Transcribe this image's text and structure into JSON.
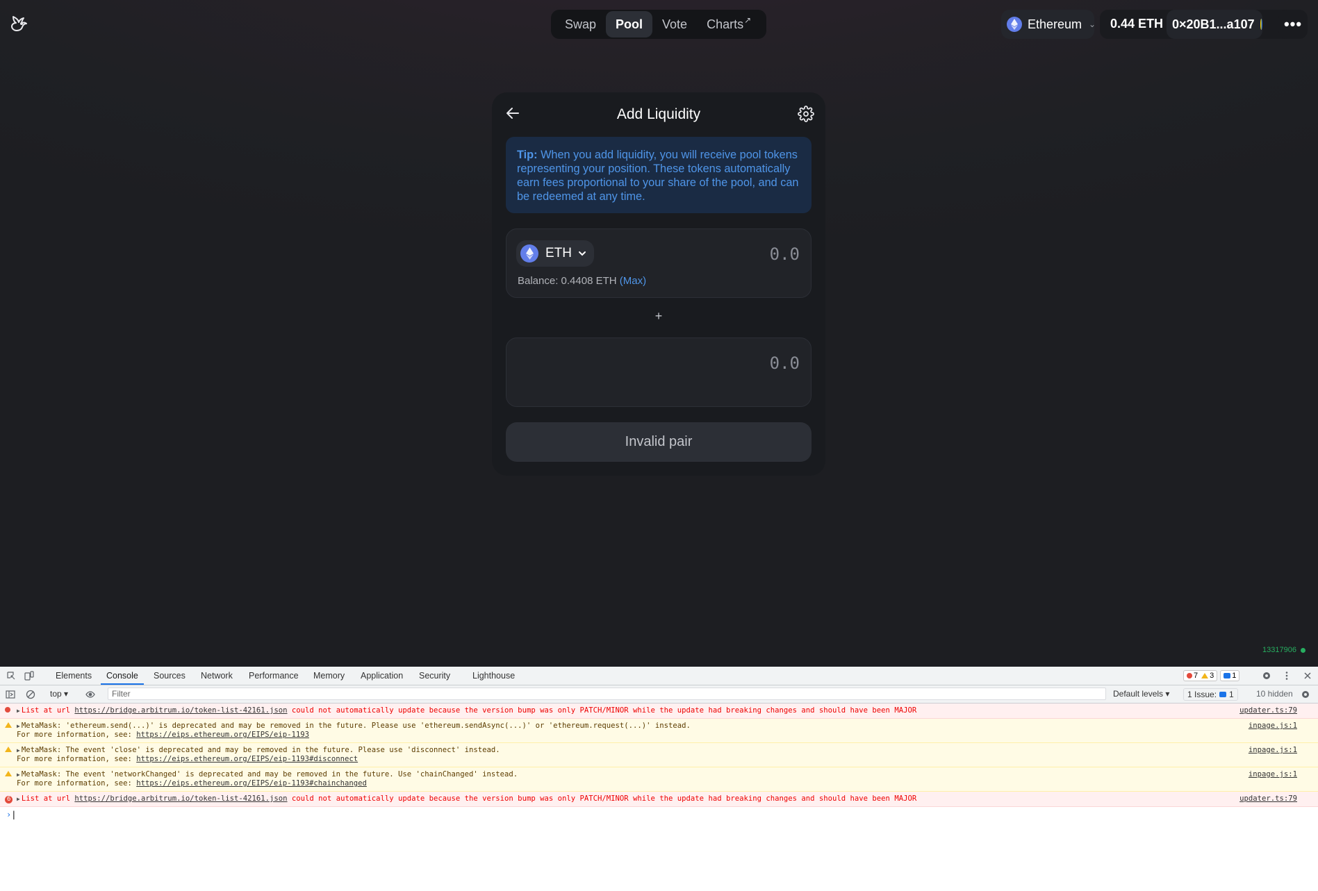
{
  "nav": {
    "items": [
      "Swap",
      "Pool",
      "Vote",
      "Charts"
    ],
    "active": "Pool",
    "external_icon": "↗"
  },
  "wallet": {
    "chain": "Ethereum",
    "balance": "0.44 ETH",
    "address": "0×20B1...a107",
    "more": "•••"
  },
  "card": {
    "title": "Add Liquidity",
    "tip_label": "Tip:",
    "tip_text": " When you add liquidity, you will receive pool tokens representing your position. These tokens automatically earn fees proportional to your share of the pool, and can be redeemed at any time.",
    "input_a": {
      "token": "ETH",
      "amount_placeholder": "0.0",
      "balance_label": "Balance: 0.4408 ETH",
      "max_label": "(Max)"
    },
    "plus": "+",
    "input_b": {
      "amount_placeholder": "0.0"
    },
    "button": "Invalid pair"
  },
  "block_number": "13317906",
  "devtools": {
    "tabs": [
      "Elements",
      "Console",
      "Sources",
      "Network",
      "Performance",
      "Memory",
      "Application",
      "Security",
      "Lighthouse"
    ],
    "active_tab": "Console",
    "counts": {
      "errors": "7",
      "warnings": "3",
      "messages": "1"
    },
    "context": "top ▾",
    "filter_placeholder": "Filter",
    "levels": "Default levels ▾",
    "issues_label": "1 Issue:",
    "issues_count": "1",
    "hidden": "10 hidden",
    "messages": [
      {
        "level": "error",
        "prefix": "List at url ",
        "url": "https://bridge.arbitrum.io/token-list-42161.json",
        "text": " could not automatically update because the version bump was only PATCH/MINOR while the update had breaking changes and should have been MAJOR",
        "source": "updater.ts:79"
      },
      {
        "level": "warn",
        "text": "MetaMask: 'ethereum.send(...)' is deprecated and may be removed in the future. Please use 'ethereum.sendAsync(...)' or 'ethereum.request(...)' instead.",
        "more": "For more information, see: ",
        "url": "https://eips.ethereum.org/EIPS/eip-1193",
        "source": "inpage.js:1"
      },
      {
        "level": "warn",
        "text": "MetaMask: The event 'close' is deprecated and may be removed in the future. Please use 'disconnect' instead.",
        "more": "For more information, see: ",
        "url": "https://eips.ethereum.org/EIPS/eip-1193#disconnect",
        "source": "inpage.js:1"
      },
      {
        "level": "warn",
        "text": "MetaMask: The event 'networkChanged' is deprecated and may be removed in the future. Use 'chainChanged' instead.",
        "more": "For more information, see: ",
        "url": "https://eips.ethereum.org/EIPS/eip-1193#chainchanged",
        "source": "inpage.js:1"
      },
      {
        "level": "error",
        "count": "6",
        "prefix": "List at url ",
        "url": "https://bridge.arbitrum.io/token-list-42161.json",
        "text": " could not automatically update because the version bump was only PATCH/MINOR while the update had breaking changes and should have been MAJOR",
        "source": "updater.ts:79"
      }
    ],
    "prompt": "›"
  }
}
